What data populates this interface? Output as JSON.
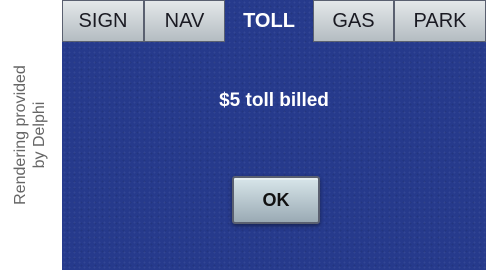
{
  "caption": {
    "line1": "Rendering provided",
    "line2": "by Delphi"
  },
  "tabs": [
    {
      "label": "SIGN",
      "active": false
    },
    {
      "label": "NAV",
      "active": false
    },
    {
      "label": "TOLL",
      "active": true
    },
    {
      "label": "GAS",
      "active": false
    },
    {
      "label": "PARK",
      "active": false
    }
  ],
  "message": "$5 toll billed",
  "ok_label": "OK",
  "colors": {
    "screen_background": "#263a8c",
    "tab_background": "#c8ced2",
    "active_tab_text": "#ffffff"
  }
}
